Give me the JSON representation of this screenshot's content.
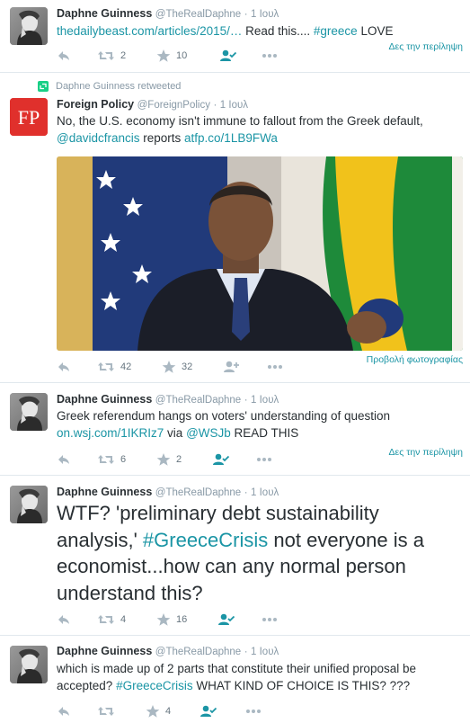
{
  "tweets": [
    {
      "name": "Daphne Guinness",
      "handle": "@TheRealDaphne",
      "sep": "·",
      "time": "1 Ιουλ",
      "text_link": "thedailybeast.com/articles/2015/…",
      "text_plain": " Read this.... ",
      "text_hashtag": "#greece",
      "text_end": " LOVE",
      "summary_link": "Δες την περίληψη",
      "retweets": "2",
      "likes": "10"
    },
    {
      "retweeted_by": "Daphne Guinness retweeted",
      "name": "Foreign Policy",
      "handle": "@ForeignPolicy",
      "sep": "·",
      "time": "1 Ιουλ",
      "text_line1": "No, the U.S. economy isn't immune to fallout from the Greek default,",
      "text_mention": "@davidcfrancis",
      "text_mid": " reports ",
      "text_link": "atfp.co/1LB9FWa",
      "photo_link": "Προβολή φωτογραφίας",
      "retweets": "42",
      "likes": "32",
      "logo_text": "FP"
    },
    {
      "name": "Daphne Guinness",
      "handle": "@TheRealDaphne",
      "sep": "·",
      "time": "1 Ιουλ",
      "text_line1": "Greek referendum hangs on voters' understanding of question",
      "text_link": "on.wsj.com/1IKRIz7",
      "text_mid": " via ",
      "text_mention": "@WSJb",
      "text_end": " READ THIS",
      "summary_link": "Δες την περίληψη",
      "retweets": "6",
      "likes": "2"
    },
    {
      "name": "Daphne Guinness",
      "handle": "@TheRealDaphne",
      "sep": "·",
      "time": "1 Ιουλ",
      "text_start": "WTF? 'preliminary debt sustainability analysis,' ",
      "text_hashtag": "#GreeceCrisis",
      "text_end": " not everyone is a economist...how can any normal person understand this?",
      "retweets": "4",
      "likes": "16"
    },
    {
      "name": "Daphne Guinness",
      "handle": "@TheRealDaphne",
      "sep": "·",
      "time": "1 Ιουλ",
      "text_start": "which is made up of 2 parts that constitute their unified proposal be accepted? ",
      "text_hashtag": "#GreeceCrisis",
      "text_end": " WHAT KIND OF CHOICE IS THIS? ???",
      "likes": "4"
    }
  ],
  "colors": {
    "link": "#1b95a5",
    "meta": "#8899a6",
    "action": "#aab8c2",
    "follow_icon": "#1b95a5",
    "fp_red": "#e0302c"
  },
  "icons": [
    "reply-icon",
    "retweet-icon",
    "like-star-icon",
    "follow-icon",
    "more-icon"
  ]
}
